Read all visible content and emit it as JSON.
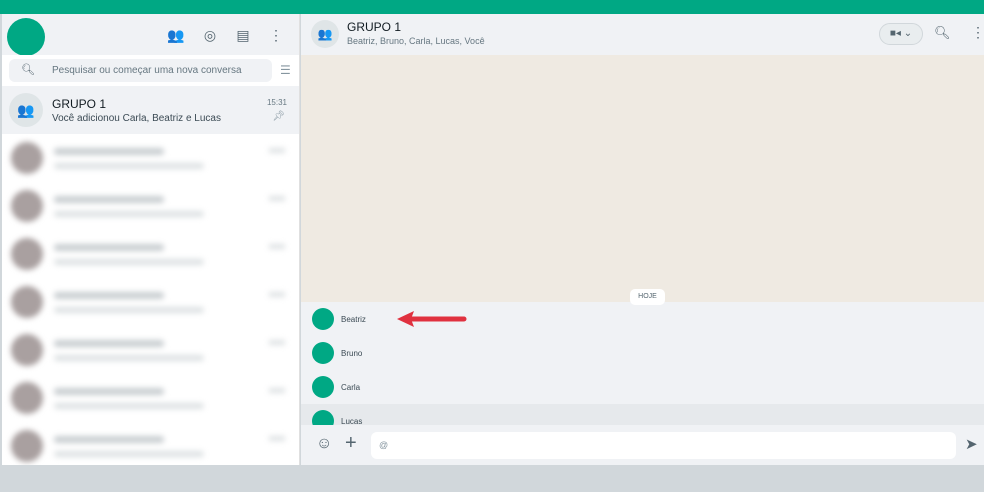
{
  "sidebar": {
    "search_placeholder": "Pesquisar ou começar uma nova conversa",
    "pinned_chat": {
      "name": "GRUPO 1",
      "last_message": "Você adicionou Carla, Beatriz e Lucas",
      "time": "15:31"
    }
  },
  "chat": {
    "title": "GRUPO 1",
    "participants": "Beatriz, Bruno, Carla, Lucas, Você",
    "date_badge": "HOJE",
    "mentions": [
      "Beatriz",
      "Bruno",
      "Carla",
      "Lucas"
    ],
    "input_value": "@"
  },
  "colors": {
    "accent": "#00a884",
    "arrow": "#e0313f"
  }
}
